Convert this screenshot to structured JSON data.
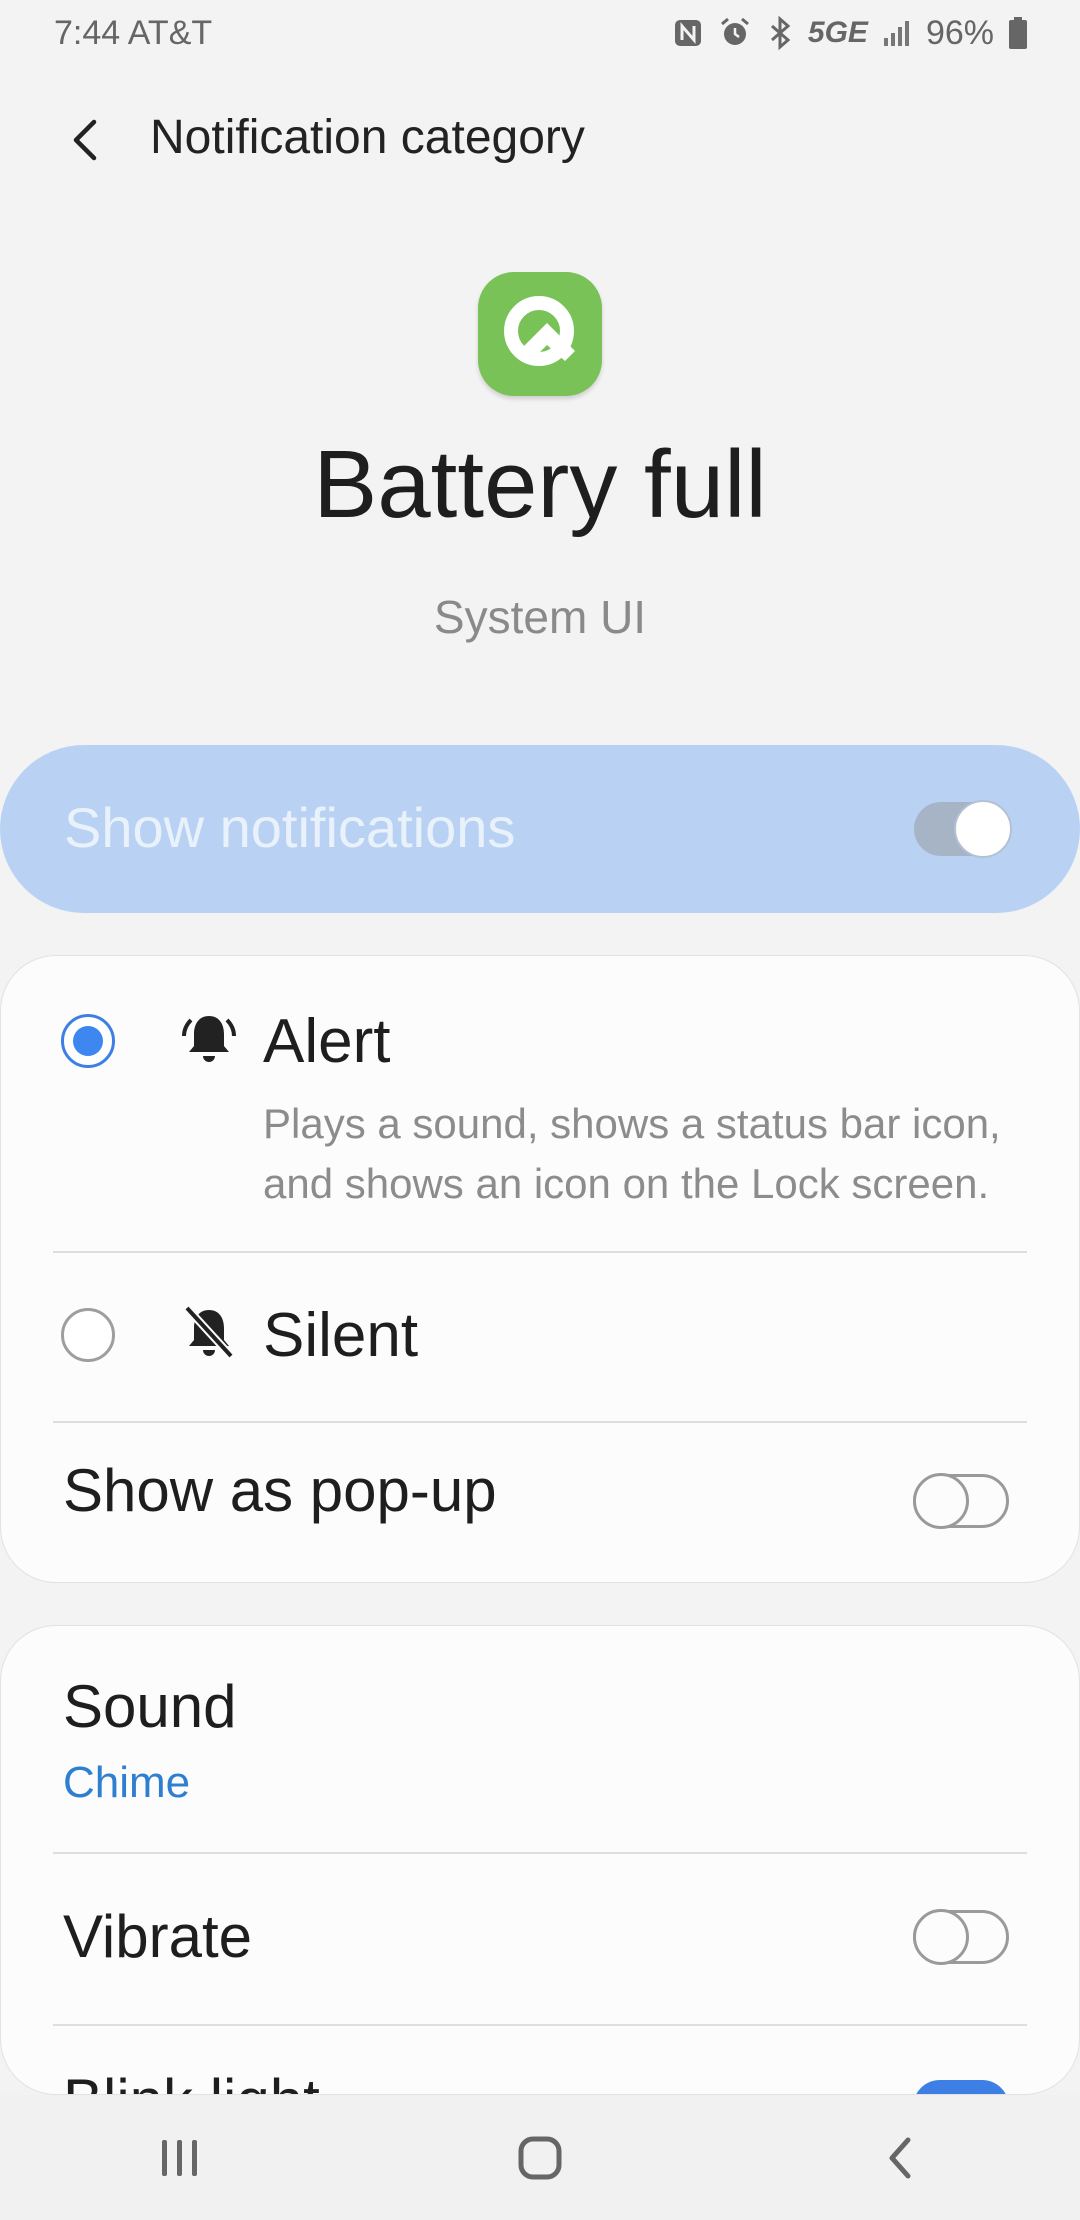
{
  "status_bar": {
    "time": "7:44",
    "carrier": "AT&T",
    "network": "5GE",
    "battery": "96%",
    "icons": [
      "nfc-icon",
      "alarm-icon",
      "bluetooth-icon",
      "signal-icon",
      "battery-icon"
    ]
  },
  "header": {
    "title": "Notification category",
    "back_icon": "back-arrow-icon"
  },
  "category": {
    "app_icon": "android-q-icon",
    "title": "Battery full",
    "app_name": "System UI"
  },
  "show_notifications": {
    "label": "Show notifications",
    "enabled": true,
    "disabled": true
  },
  "importance": {
    "options": [
      {
        "label": "Alert",
        "icon": "bell-ringing-icon",
        "description": "Plays a sound, shows a status bar icon, and shows an icon on the Lock screen.",
        "selected": true
      },
      {
        "label": "Silent",
        "icon": "bell-off-icon",
        "selected": false
      }
    ],
    "popup": {
      "label": "Show as pop-up",
      "enabled": false
    }
  },
  "settings": {
    "sound": {
      "label": "Sound",
      "value": "Chime"
    },
    "vibrate": {
      "label": "Vibrate",
      "enabled": false
    },
    "blink_light": {
      "label": "Blink light",
      "enabled": true
    }
  },
  "colors": {
    "accent": "#3e87f0",
    "master_bg": "#b9d2f3",
    "app_icon_bg": "#78c257",
    "link": "#2f7fd0"
  },
  "nav_bar": {
    "items": [
      "recents-icon",
      "home-icon",
      "back-icon"
    ]
  }
}
